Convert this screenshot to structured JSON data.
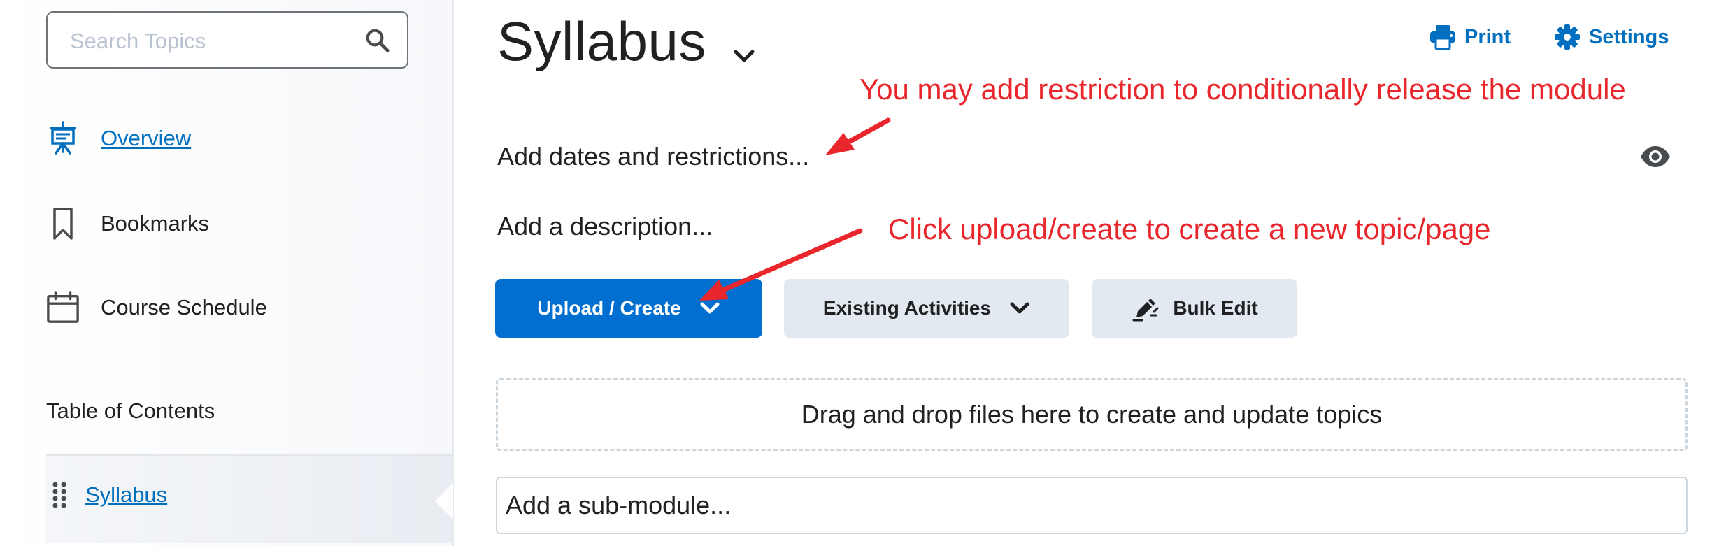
{
  "sidebar": {
    "search": {
      "placeholder": "Search Topics",
      "value": ""
    },
    "nav": [
      {
        "label": "Overview",
        "icon": "presentation-board-icon"
      },
      {
        "label": "Bookmarks",
        "icon": "bookmark-icon"
      },
      {
        "label": "Course Schedule",
        "icon": "calendar-icon"
      }
    ],
    "toc": {
      "heading": "Table of Contents",
      "items": [
        {
          "label": "Syllabus",
          "selected": true
        }
      ]
    }
  },
  "main": {
    "title": "Syllabus",
    "actions": {
      "print": "Print",
      "settings": "Settings"
    },
    "dates_restrictions": "Add dates and restrictions...",
    "description": "Add a description...",
    "buttons": {
      "upload_create": "Upload / Create",
      "existing_activities": "Existing Activities",
      "bulk_edit": "Bulk Edit"
    },
    "dropzone": "Drag and drop files here to create and update topics",
    "submodule": "Add a sub-module..."
  },
  "annotations": {
    "restriction_note": "You may add restriction to conditionally release the module",
    "upload_note": "Click upload/create to create a new topic/page"
  },
  "colors": {
    "accent": "#006fcf",
    "link": "#006fbf",
    "annotation": "#e8262b",
    "secondary_button": "#e3e9f1"
  }
}
